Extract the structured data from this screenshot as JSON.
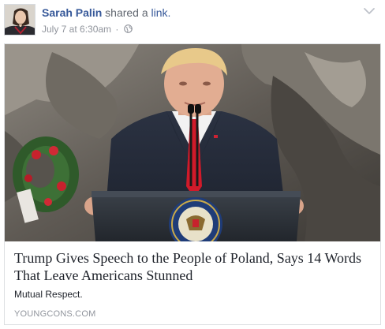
{
  "post": {
    "author": "Sarah Palin",
    "action": "shared a",
    "action_link": "link.",
    "timestamp": "July 7 at 6:30am",
    "separator": "·",
    "privacy_icon": "globe-icon",
    "menu_icon": "chevron-down-icon"
  },
  "link_card": {
    "title": "Trump Gives Speech to the People of Poland, Says 14 Words That Leave Americans Stunned",
    "description": "Mutual Respect.",
    "domain": "YOUNGCONS.COM"
  },
  "colors": {
    "link_blue": "#365899",
    "meta_gray": "#90949c",
    "border": "#dddfe2"
  }
}
